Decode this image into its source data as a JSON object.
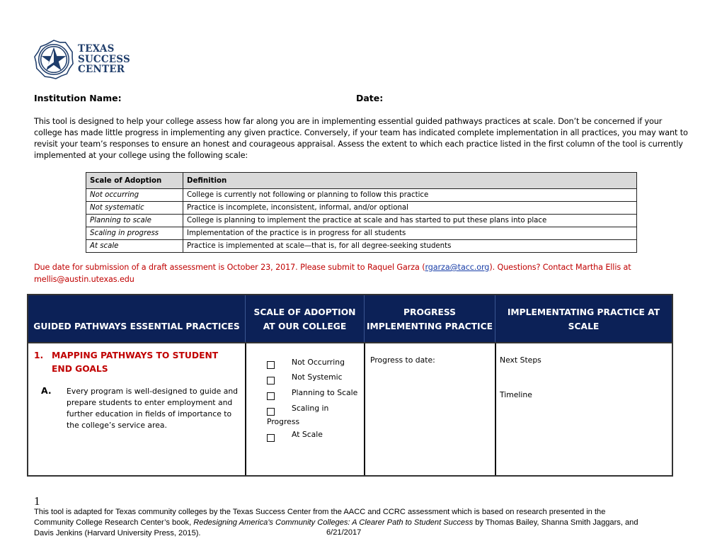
{
  "logo": {
    "icon": "texas-star-seal-icon",
    "lines": [
      "TEXAS",
      "SUCCESS",
      "CENTER"
    ],
    "color": "#1f3d6b"
  },
  "form": {
    "institution_label": "Institution Name:",
    "date_label": "Date:"
  },
  "intro": "This tool is designed to help your college assess how far along you are in implementing essential guided pathways practices at scale. Don’t be concerned if your college has made little progress in implementing any given practice. Conversely, if your team has indicated complete implementation in all practices, you may want to revisit your team’s responses to ensure an honest and courageous appraisal. Assess the extent to which each practice listed in the first column of the tool is currently implemented at your college using the following scale:",
  "scale_table": {
    "headers": [
      "Scale of Adoption",
      "Definition"
    ],
    "rows": [
      {
        "term": "Not occurring",
        "definition": "College is currently not following or planning to follow this practice"
      },
      {
        "term": "Not systematic",
        "definition": "Practice is incomplete, inconsistent, informal, and/or optional"
      },
      {
        "term": "Planning to scale",
        "definition": "College is planning to implement the practice at scale and has started to put these plans into place"
      },
      {
        "term": "Scaling in progress",
        "definition": "Implementation of the practice is in progress for all students"
      },
      {
        "term": "At scale",
        "definition": "Practice is implemented at scale—that is, for all degree-seeking students"
      }
    ]
  },
  "due_notice": {
    "text_before": "Due date for submission of a draft assessment is October 23, 2017. Please submit to Raquel Garza (",
    "link": "rgarza@tacc.org",
    "text_after": "). Questions?  Contact Martha Ellis at mellis@austin.utexas.edu",
    "color": "#c00000"
  },
  "main_table": {
    "header_bg": "#0c2157",
    "headers": [
      [
        "GUIDED PATHWAYS ESSENTIAL PRACTICES"
      ],
      [
        "SCALE OF ADOPTION",
        "AT OUR COLLEGE"
      ],
      [
        "PROGRESS",
        "IMPLEMENTING PRACTICE"
      ],
      [
        "IMPLEMENTATING PRACTICE AT",
        "SCALE"
      ]
    ],
    "section": {
      "number": "1.",
      "title": "MAPPING PATHWAYS TO STUDENT END GOALS"
    },
    "practice": {
      "letter": "A.",
      "text": "Every program is well-designed to guide and prepare students to enter employment and further education in fields of importance to the college’s service area."
    },
    "adoption_options": [
      {
        "label": "Not Occurring",
        "checked": false
      },
      {
        "label": "Not Systemic",
        "checked": false
      },
      {
        "label": "Planning to Scale",
        "checked": false
      },
      {
        "label": "Scaling in",
        "label_wrap": "Progress",
        "checked": false
      },
      {
        "label": "At Scale",
        "checked": false
      }
    ],
    "progress_label": "Progress to date:",
    "next_steps_label": "Next Steps",
    "timeline_label": "Timeline"
  },
  "footer": {
    "footnote_number": "1",
    "line1": "This tool is adapted for Texas community colleges by the Texas Success Center from the AACC and CCRC assessment which is based on research presented in the",
    "line2_before": "Community College Research Center’s book, ",
    "line2_italic": "Redesigning America's Community Colleges: A Clearer Path to Student Success",
    "line2_after": " by Thomas Bailey, Shanna Smith Jaggars, and",
    "line3": "Davis Jenkins (Harvard University Press, 2015).",
    "date": "6/21/2017"
  }
}
